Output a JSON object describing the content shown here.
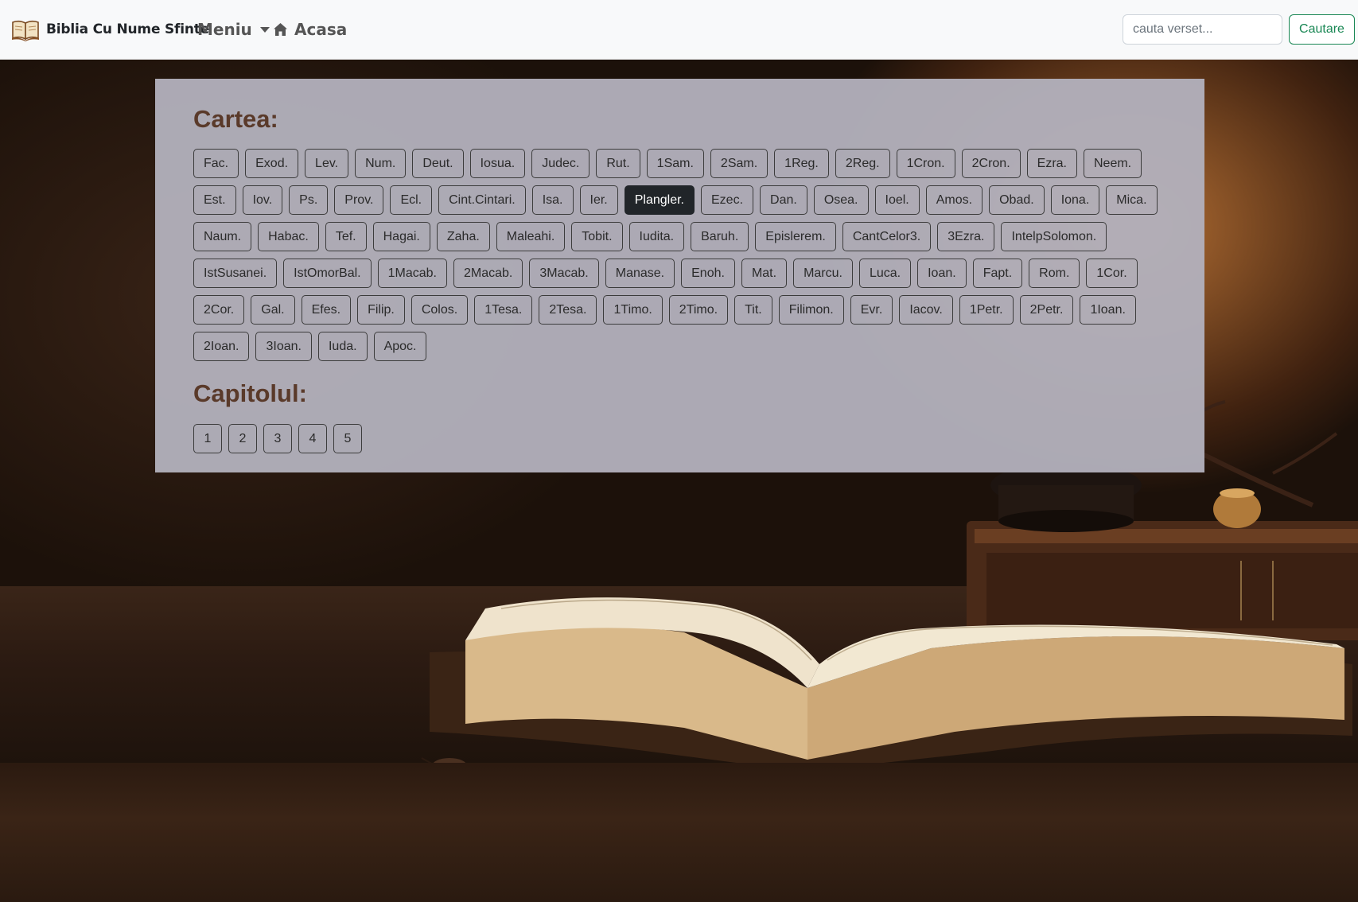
{
  "navbar": {
    "brand_icon": "open-book-icon",
    "brand": "Biblia Cu Nume Sfinte",
    "menu_label": "Meniu",
    "home_icon": "house-icon",
    "home_label": "Acasa",
    "search_placeholder": "cauta verset...",
    "search_button": "Cautare"
  },
  "colors": {
    "heading": "#5a3a2a",
    "active_button_bg": "#212529",
    "search_button": "#198754"
  },
  "books_heading": "Cartea:",
  "books": [
    [
      "Fac.",
      "Exod.",
      "Lev.",
      "Num.",
      "Deut.",
      "Iosua.",
      "Judec.",
      "Rut.",
      "1Sam.",
      "2Sam.",
      "1Reg.",
      "2Reg.",
      "1Cron.",
      "2Cron.",
      "Ezra.",
      "Neem."
    ],
    [
      "Est.",
      "Iov.",
      "Ps.",
      "Prov.",
      "Ecl.",
      "Cint.Cintari.",
      "Isa.",
      "Ier.",
      "Plangler.",
      "Ezec.",
      "Dan.",
      "Osea.",
      "Ioel.",
      "Amos.",
      "Obad.",
      "Iona.",
      "Mica."
    ],
    [
      "Naum.",
      "Habac.",
      "Tef.",
      "Hagai.",
      "Zaha.",
      "Maleahi.",
      "Tobit.",
      "Iudita.",
      "Baruh.",
      "Epislerem.",
      "CantCelor3.",
      "3Ezra.",
      "IntelpSolomon."
    ],
    [
      "IstSusanei.",
      "IstOmorBal.",
      "1Macab.",
      "2Macab.",
      "3Macab.",
      "Manase.",
      "Enoh.",
      "Mat.",
      "Marcu.",
      "Luca.",
      "Ioan.",
      "Fapt.",
      "Rom.",
      "1Cor."
    ],
    [
      "2Cor.",
      "Gal.",
      "Efes.",
      "Filip.",
      "Colos.",
      "1Tesa.",
      "2Tesa.",
      "1Timo.",
      "2Timo.",
      "Tit.",
      "Filimon.",
      "Evr.",
      "Iacov.",
      "1Petr.",
      "2Petr.",
      "1Ioan."
    ],
    [
      "2Ioan.",
      "3Ioan.",
      "Iuda.",
      "Apoc."
    ]
  ],
  "selected_book": "Plangler.",
  "chapters_heading": "Capitolul:",
  "chapters": [
    "1",
    "2",
    "3",
    "4",
    "5"
  ]
}
